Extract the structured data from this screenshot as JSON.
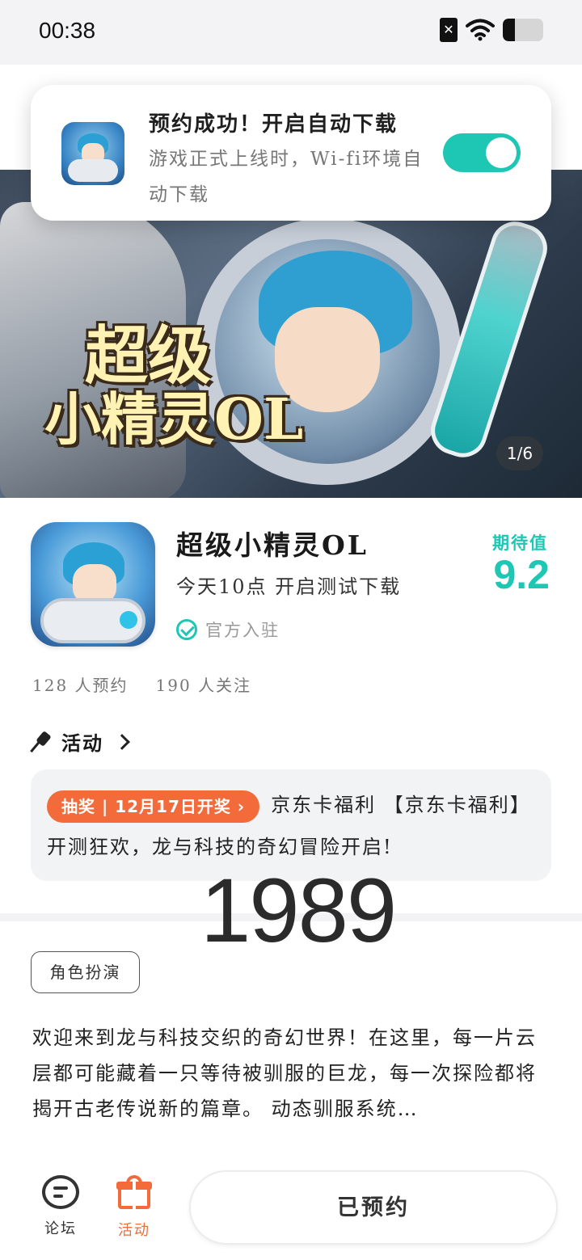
{
  "status_bar": {
    "time": "00:38",
    "sim_icon": "sim-off-icon",
    "wifi_icon": "wifi-icon",
    "battery_level": 0.3
  },
  "toast": {
    "title": "预约成功！开启自动下载",
    "description": "游戏正式上线时，Wi-fi环境自动下载",
    "toggle_on": true
  },
  "banner": {
    "title_line1": "超级",
    "title_line2": "小精灵OL",
    "pager": "1/6"
  },
  "app": {
    "name": "超级小精灵OL",
    "subtitle": "今天10点 开启测试下载",
    "official_label": "官方入驻",
    "expect_label": "期待值",
    "expect_score": "9.2",
    "reservations": "128 人预约",
    "followers": "190 人关注"
  },
  "activity": {
    "header": "活动",
    "tag": "抽奖 | 12月17日开奖 ›",
    "text": "京东卡福利 【京东卡福利】开测狂欢，龙与科技的奇幻冒险开启!"
  },
  "overlay_number": "1989",
  "genre_tag": "角色扮演",
  "description": "欢迎来到龙与科技交织的奇幻世界！在这里，每一片云层都可能藏着一只等待被驯服的巨龙，每一次探险都将揭开古老传说新的篇章。 动态驯服系统…",
  "bottom_nav": {
    "forum_label": "论坛",
    "activity_label": "活动",
    "reserve_button": "已预约"
  },
  "colors": {
    "accent_teal": "#1ec7b4",
    "accent_orange": "#f36b3a"
  }
}
